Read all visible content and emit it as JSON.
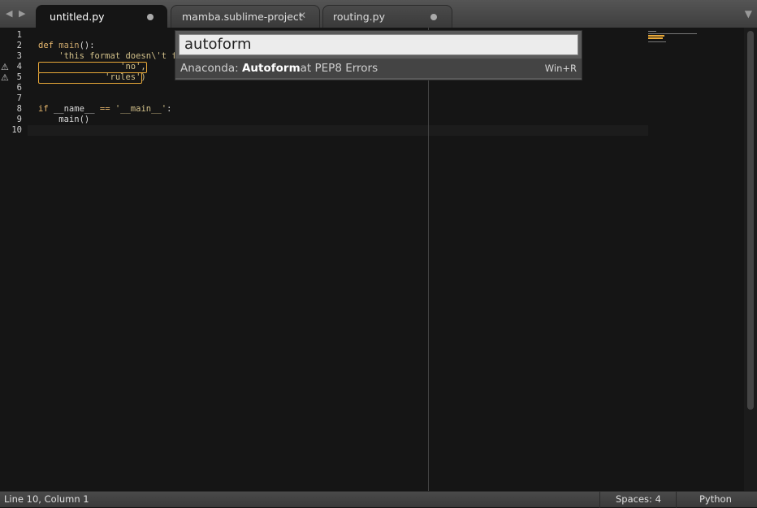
{
  "tabs": [
    {
      "label": "untitled.py",
      "state": "modified"
    },
    {
      "label": "mamba.sublime-project",
      "state": "close"
    },
    {
      "label": "routing.py",
      "state": "modified"
    }
  ],
  "nav_icons": [
    "arrow-left-icon",
    "arrow-right-icon"
  ],
  "line_numbers": [
    "1",
    "2",
    "3",
    "4",
    "5",
    "6",
    "7",
    "8",
    "9",
    "10"
  ],
  "code": {
    "l2_kw": "def ",
    "l2_fn": "main",
    "l2_rest": "():",
    "l3": "    'this format doesn\\'t fo",
    "l4": "                'no',",
    "l5": "             'rules')",
    "l8_kw": "if ",
    "l8_name": "__name__",
    "l8_op": " == ",
    "l8_str": "'__main__'",
    "l8_colon": ":",
    "l9": "    main()"
  },
  "palette": {
    "query": "autoform",
    "item_prefix": "Anaconda: ",
    "item_match": "Autoform",
    "item_suffix": "at PEP8 Errors",
    "item_key": "Win+R"
  },
  "status": {
    "position": "Line 10, Column 1",
    "indent": "Spaces: 4",
    "syntax": "Python"
  },
  "colors": {
    "accent_warning": "#e8a838",
    "keyword": "#e9b96e",
    "string": "#d2c08a"
  }
}
